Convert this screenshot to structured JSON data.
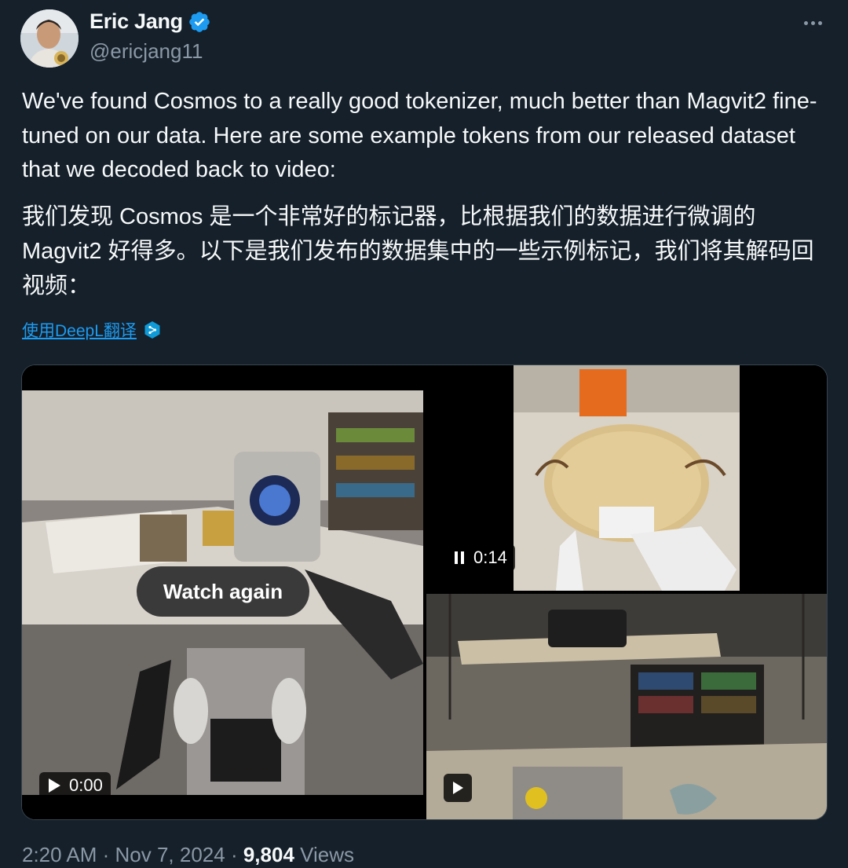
{
  "author": {
    "name": "Eric Jang",
    "handle": "@ericjang11"
  },
  "tweet": {
    "text_en": "We've found Cosmos to a really good tokenizer, much better than Magvit2 fine-tuned on our data. Here are some example tokens from our released dataset that we decoded back to video:",
    "text_zh": "我们发现 Cosmos 是一个非常好的标记器，比根据我们的数据进行微调的 Magvit2 好得多。以下是我们发布的数据集中的一些示例标记，我们将其解码回视频：",
    "translate_label": "使用DeepL翻译"
  },
  "media": {
    "video_left": {
      "timestamp": "0:00",
      "watch_again_label": "Watch again"
    },
    "video_top_right": {
      "timestamp": "0:14"
    },
    "video_bottom_right": {}
  },
  "footer": {
    "time": "2:20 AM",
    "date": "Nov 7, 2024",
    "views_count": "9,804",
    "views_label": "Views"
  },
  "colors": {
    "background": "#15202b",
    "text_primary": "#f7f9f9",
    "text_secondary": "#8b98a5",
    "accent": "#1d9bf0"
  },
  "icons": [
    "verified-badge-icon",
    "more-options-icon",
    "deepl-icon",
    "play-icon",
    "pause-icon"
  ]
}
